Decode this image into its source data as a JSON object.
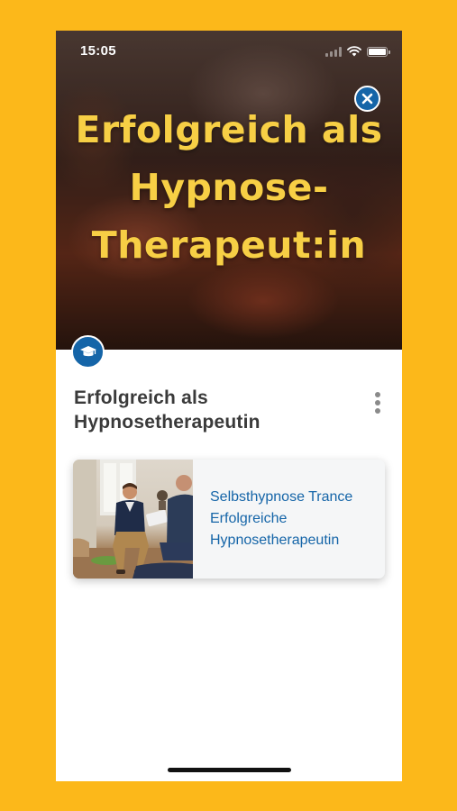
{
  "status_bar": {
    "time": "15:05"
  },
  "hero": {
    "title_lines": [
      "Erfolgreich als",
      "Hypnose-",
      "Therapeut:in"
    ],
    "close_icon": "close-x-icon",
    "badge_icon": "graduation-cap-icon"
  },
  "course": {
    "title": "Erfolgreich als Hypnosetherapeutin",
    "more_icon": "vertical-dots-icon"
  },
  "lessons": [
    {
      "title": "Selbsthypnose Trance Erfolgreiche Hypnosetherapeutin"
    }
  ],
  "colors": {
    "background": "#FCB81A",
    "accent_blue": "#1565A8",
    "hero_title": "#F7CF45",
    "card_bg": "#f5f6f7",
    "title_text": "#3a3a3a"
  }
}
